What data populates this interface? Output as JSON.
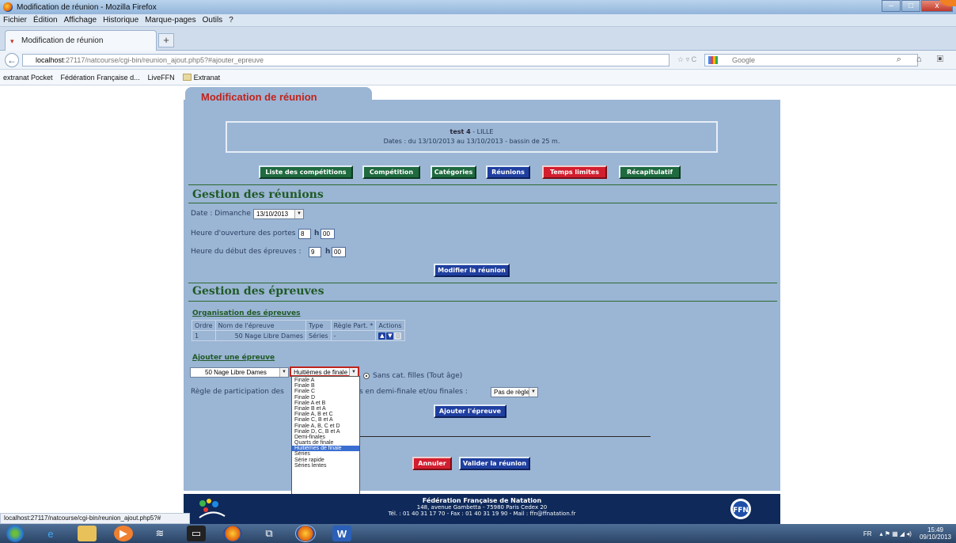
{
  "window": {
    "title": "Modification de réunion - Mozilla Firefox",
    "controls": {
      "minimize": "–",
      "maximize": "□",
      "close": "x"
    }
  },
  "menubar": [
    "Fichier",
    "Édition",
    "Affichage",
    "Historique",
    "Marque-pages",
    "Outils",
    "?"
  ],
  "tab": {
    "label": "Modification de réunion",
    "new_tab": "+"
  },
  "nav": {
    "back": "←",
    "url_host": "localhost",
    "url_rest": ":27117/natcourse/cgi-bin/reunion_ajout.php5?#ajouter_epreuve",
    "url_icons": "☆ ▿ C",
    "search_placeholder": "Google",
    "right_icons": "⌕ ⌂ ▣"
  },
  "bookmarks": [
    "extranat Pocket",
    "Fédération Française d...",
    "LiveFFN",
    "Extranat"
  ],
  "page": {
    "tab_title": "Modification de réunion",
    "competition_name": "test 4",
    "competition_city": " - LILLE",
    "dates_line": "Dates : du 13/10/2013 au 13/10/2013 - bassin de 25 m.",
    "nav_buttons": [
      {
        "label": "Liste des compétitions"
      },
      {
        "label": "Compétition"
      },
      {
        "label": "Catégories"
      },
      {
        "label": "Réunions"
      },
      {
        "label": "Temps limites"
      },
      {
        "label": "Récapitulatif"
      }
    ],
    "gestion_reunions": {
      "title": "Gestion des réunions",
      "date_label": "Date : Dimanche",
      "date_value": "13/10/2013",
      "ouverture_label": "Heure d'ouverture des portes :",
      "ouverture_h": "8",
      "ouverture_m": "00",
      "debut_label": "Heure du début des épreuves :",
      "debut_h": "9",
      "debut_m": "00",
      "h_sep": "h",
      "modify_button": "Modifier la réunion"
    },
    "gestion_epreuves": {
      "title": "Gestion des épreuves",
      "organisation_title": "Organisation des épreuves",
      "table_headers": [
        "Ordre",
        "Nom de l'épreuve",
        "Type",
        "Règle Part. *",
        "Actions"
      ],
      "table_rows": [
        {
          "ordre": "1",
          "nom": "50 Nage Libre Dames",
          "type": "Séries",
          "regle": "-"
        }
      ],
      "ajouter_title": "Ajouter une épreuve",
      "epreuve_select": "50 Nage Libre Dames",
      "type_select": "Huitièmes de finale",
      "radio_label": "Sans cat. filles (Tout âge)",
      "regle_label_start": "Règle de participation des",
      "regle_label_end": "s en demi-finale et/ou finales :",
      "regle_select": "Pas de règle",
      "add_button": "Ajouter l'épreuve",
      "dropdown_options": [
        "Finale A",
        "Finale B",
        "Finale C",
        "Finale D",
        "Finale A et B",
        "Finale B et A",
        "Finale A, B et C",
        "Finale C, B et A",
        "Finale A, B, C et D",
        "Finale D, C, B et A",
        "Demi-finales",
        "Quarts de finale",
        "Huitièmes de finale",
        "Séries",
        "Série rapide",
        "Séries lentes"
      ],
      "dropdown_selected_index": 12
    },
    "cancel_button": "Annuler",
    "validate_button": "Valider la réunion"
  },
  "footer": {
    "name": "Fédération Française de Natation",
    "address": "148, avenue Gambetta - 75980 Paris Cedex 20",
    "contact": "Tél. : 01 40 31 17 70 - Fax : 01 40 31 19 90 - Mail : ffn@ffnatation.fr",
    "logo_right_text": "FFN"
  },
  "status": "localhost:27117/natcourse/cgi-bin/reunion_ajout.php5?#",
  "taskbar": {
    "lang": "FR",
    "time": "15:49",
    "date": "09/10/2013"
  },
  "colors": {
    "panel": "#9bb5d4",
    "green_btn": "#1f6a3f",
    "blue_btn": "#1f3fa0",
    "red_btn": "#d21e2e",
    "section_title": "#1f5a26",
    "footer": "#0f2a5a"
  }
}
